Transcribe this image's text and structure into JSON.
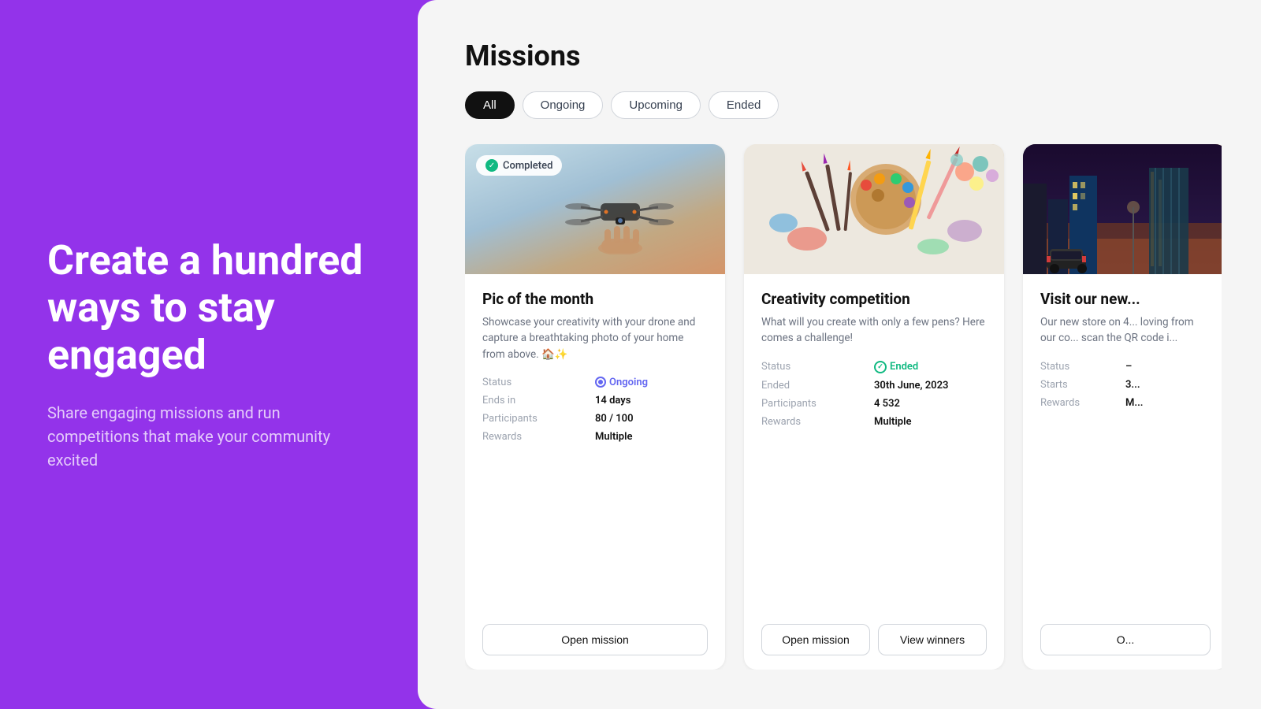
{
  "left": {
    "headline": "Create a hundred ways to stay engaged",
    "subtext": "Share engaging missions and run competitions that make your community excited"
  },
  "right": {
    "title": "Missions",
    "filters": [
      {
        "label": "All",
        "active": true
      },
      {
        "label": "Ongoing",
        "active": false
      },
      {
        "label": "Upcoming",
        "active": false
      },
      {
        "label": "Ended",
        "active": false
      }
    ],
    "cards": [
      {
        "id": "card-1",
        "badge": "Completed",
        "image_type": "drone",
        "title": "Pic of the month",
        "description": "Showcase your creativity with your drone and capture a breathtaking photo of your home from above. 🏠✨",
        "status_label": "Status",
        "status_value": "Ongoing",
        "ends_in_label": "Ends in",
        "ends_in_value": "14 days",
        "participants_label": "Participants",
        "participants_value": "80 / 100",
        "rewards_label": "Rewards",
        "rewards_value": "Multiple",
        "btn1": "Open mission"
      },
      {
        "id": "card-2",
        "badge": null,
        "image_type": "art",
        "title": "Creativity competition",
        "description": "What will you create with only a few pens? Here comes a challenge!",
        "status_label": "Status",
        "status_value": "Ended",
        "ended_label": "Ended",
        "ended_value": "30th June, 2023",
        "participants_label": "Participants",
        "participants_value": "4 532",
        "rewards_label": "Rewards",
        "rewards_value": "Multiple",
        "btn1": "Open mission",
        "btn2": "View winners"
      },
      {
        "id": "card-3",
        "badge": null,
        "image_type": "city",
        "title": "Visit our new...",
        "description": "Our new store on 4... loving from our co... scan the QR code i...",
        "status_label": "Status",
        "starts_label": "Starts",
        "starts_value": "3...",
        "rewards_label": "Rewards",
        "rewards_value": "M...",
        "btn1": "O..."
      }
    ]
  }
}
